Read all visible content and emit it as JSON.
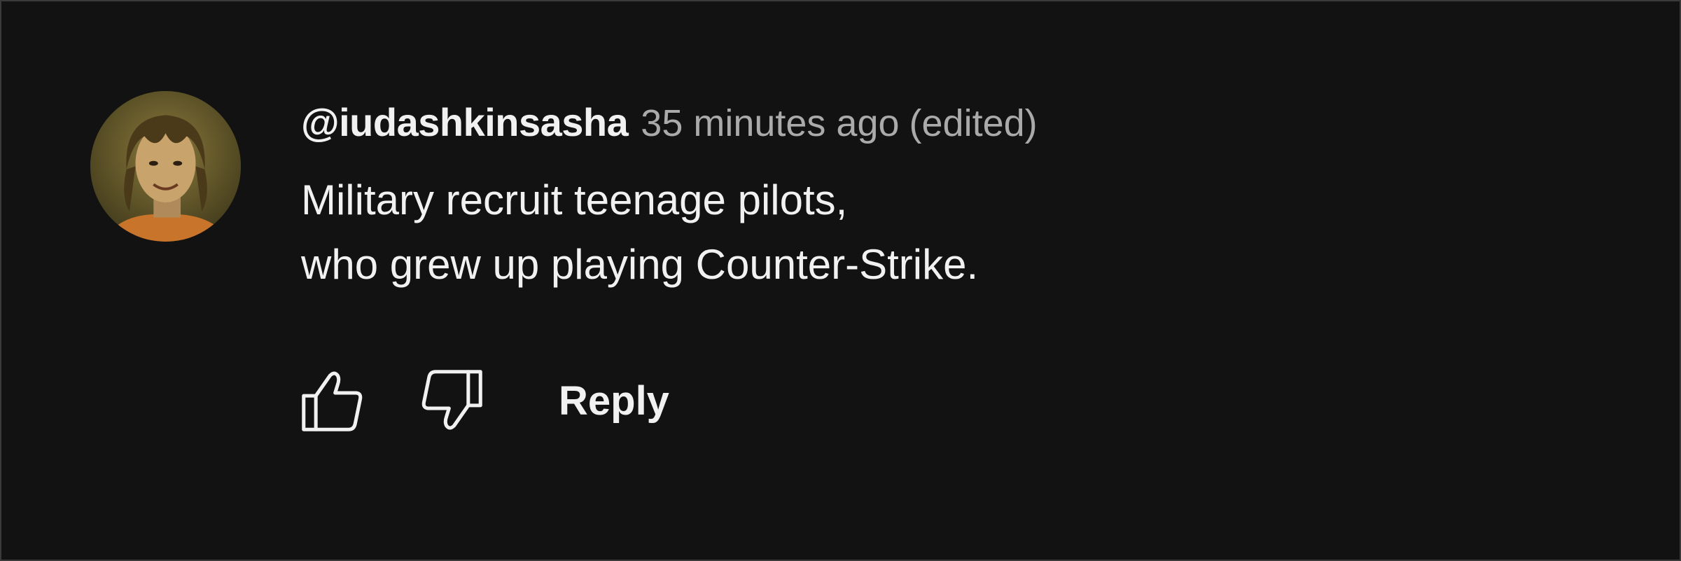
{
  "comment": {
    "author": "@iudashkinsasha",
    "timestamp": "35 minutes ago",
    "edited_label": "(edited)",
    "lines": [
      "Military recruit teenage pilots,",
      "who grew up playing Counter-Strike."
    ]
  },
  "actions": {
    "like_icon": "thumbs-up-icon",
    "dislike_icon": "thumbs-down-icon",
    "reply_label": "Reply"
  },
  "colors": {
    "background": "#121212",
    "text_primary": "#f1f1f1",
    "text_secondary": "#aaaaaa"
  }
}
